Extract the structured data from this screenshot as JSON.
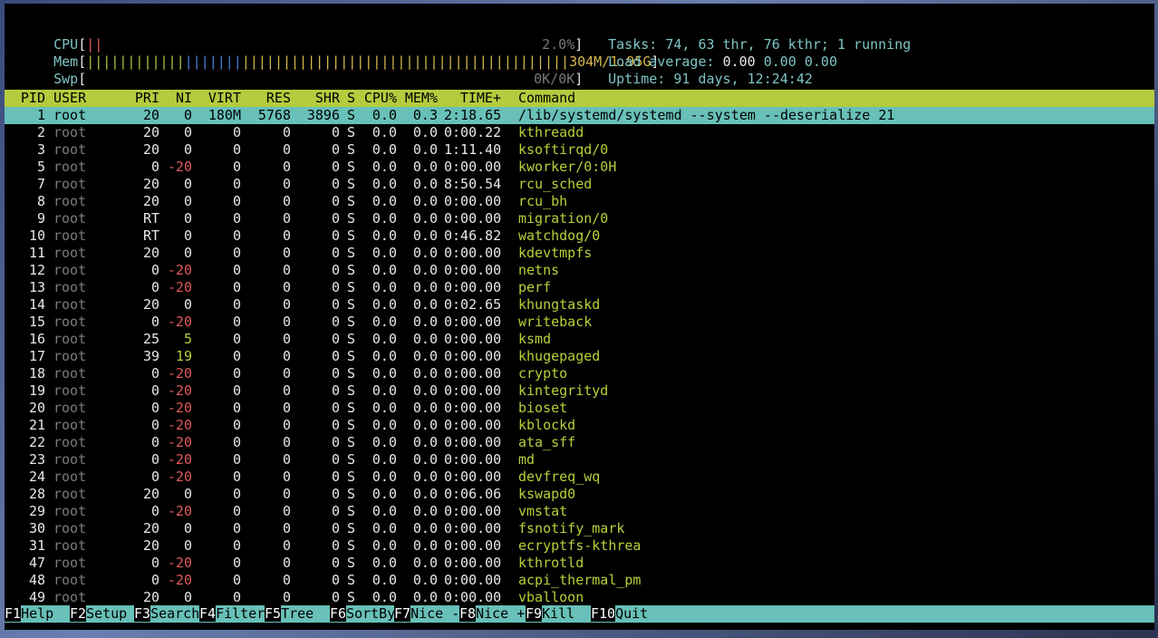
{
  "meters": {
    "cpu": {
      "label": "CPU",
      "bar": "||",
      "value": "2.0%"
    },
    "mem": {
      "label": "Mem",
      "bar_green": "||||||||||||",
      "bar_blue": "|||||||",
      "bar_yellow": "||||||||||||||||||||||||||||||||||||||||",
      "value": "304M/1.95G"
    },
    "swp": {
      "label": "Swp",
      "value": "0K/0K"
    }
  },
  "summary": {
    "tasks_label": "Tasks: ",
    "tasks": "74",
    "thr_sep": ", ",
    "thr": "63",
    "thr_label": " thr, ",
    "kthr": "76",
    "kthr_label": " kthr; ",
    "running": "1",
    "running_label": " running",
    "load_label": "Load average: ",
    "load1": "0.00",
    "load5": "0.00",
    "load15": "0.00",
    "uptime_label": "Uptime: ",
    "uptime": "91 days, 12:24:42"
  },
  "columns": {
    "pid": "PID",
    "user": "USER",
    "pri": "PRI",
    "ni": "NI",
    "virt": "VIRT",
    "res": "RES",
    "shr": "SHR",
    "s": "S",
    "cpu": "CPU%",
    "mem": "MEM%",
    "time": "TIME+",
    "command": "Command"
  },
  "processes": [
    {
      "pid": "1",
      "user": "root",
      "pri": "20",
      "ni": "0",
      "virt": "180M",
      "res": "5768",
      "shr": "3896",
      "s": "S",
      "cpu": "0.0",
      "mem": "0.3",
      "time": "2:18.65",
      "command": "/lib/systemd/systemd --system --deserialize 21"
    },
    {
      "pid": "2",
      "user": "root",
      "pri": "20",
      "ni": "0",
      "virt": "0",
      "res": "0",
      "shr": "0",
      "s": "S",
      "cpu": "0.0",
      "mem": "0.0",
      "time": "0:00.22",
      "command": "kthreadd"
    },
    {
      "pid": "3",
      "user": "root",
      "pri": "20",
      "ni": "0",
      "virt": "0",
      "res": "0",
      "shr": "0",
      "s": "S",
      "cpu": "0.0",
      "mem": "0.0",
      "time": "1:11.40",
      "command": "ksoftirqd/0"
    },
    {
      "pid": "5",
      "user": "root",
      "pri": "0",
      "ni": "-20",
      "virt": "0",
      "res": "0",
      "shr": "0",
      "s": "S",
      "cpu": "0.0",
      "mem": "0.0",
      "time": "0:00.00",
      "command": "kworker/0:0H"
    },
    {
      "pid": "7",
      "user": "root",
      "pri": "20",
      "ni": "0",
      "virt": "0",
      "res": "0",
      "shr": "0",
      "s": "S",
      "cpu": "0.0",
      "mem": "0.0",
      "time": "8:50.54",
      "command": "rcu_sched"
    },
    {
      "pid": "8",
      "user": "root",
      "pri": "20",
      "ni": "0",
      "virt": "0",
      "res": "0",
      "shr": "0",
      "s": "S",
      "cpu": "0.0",
      "mem": "0.0",
      "time": "0:00.00",
      "command": "rcu_bh"
    },
    {
      "pid": "9",
      "user": "root",
      "pri": "RT",
      "ni": "0",
      "virt": "0",
      "res": "0",
      "shr": "0",
      "s": "S",
      "cpu": "0.0",
      "mem": "0.0",
      "time": "0:00.00",
      "command": "migration/0"
    },
    {
      "pid": "10",
      "user": "root",
      "pri": "RT",
      "ni": "0",
      "virt": "0",
      "res": "0",
      "shr": "0",
      "s": "S",
      "cpu": "0.0",
      "mem": "0.0",
      "time": "0:46.82",
      "command": "watchdog/0"
    },
    {
      "pid": "11",
      "user": "root",
      "pri": "20",
      "ni": "0",
      "virt": "0",
      "res": "0",
      "shr": "0",
      "s": "S",
      "cpu": "0.0",
      "mem": "0.0",
      "time": "0:00.00",
      "command": "kdevtmpfs"
    },
    {
      "pid": "12",
      "user": "root",
      "pri": "0",
      "ni": "-20",
      "virt": "0",
      "res": "0",
      "shr": "0",
      "s": "S",
      "cpu": "0.0",
      "mem": "0.0",
      "time": "0:00.00",
      "command": "netns"
    },
    {
      "pid": "13",
      "user": "root",
      "pri": "0",
      "ni": "-20",
      "virt": "0",
      "res": "0",
      "shr": "0",
      "s": "S",
      "cpu": "0.0",
      "mem": "0.0",
      "time": "0:00.00",
      "command": "perf"
    },
    {
      "pid": "14",
      "user": "root",
      "pri": "20",
      "ni": "0",
      "virt": "0",
      "res": "0",
      "shr": "0",
      "s": "S",
      "cpu": "0.0",
      "mem": "0.0",
      "time": "0:02.65",
      "command": "khungtaskd"
    },
    {
      "pid": "15",
      "user": "root",
      "pri": "0",
      "ni": "-20",
      "virt": "0",
      "res": "0",
      "shr": "0",
      "s": "S",
      "cpu": "0.0",
      "mem": "0.0",
      "time": "0:00.00",
      "command": "writeback"
    },
    {
      "pid": "16",
      "user": "root",
      "pri": "25",
      "ni": "5",
      "virt": "0",
      "res": "0",
      "shr": "0",
      "s": "S",
      "cpu": "0.0",
      "mem": "0.0",
      "time": "0:00.00",
      "command": "ksmd"
    },
    {
      "pid": "17",
      "user": "root",
      "pri": "39",
      "ni": "19",
      "virt": "0",
      "res": "0",
      "shr": "0",
      "s": "S",
      "cpu": "0.0",
      "mem": "0.0",
      "time": "0:00.00",
      "command": "khugepaged"
    },
    {
      "pid": "18",
      "user": "root",
      "pri": "0",
      "ni": "-20",
      "virt": "0",
      "res": "0",
      "shr": "0",
      "s": "S",
      "cpu": "0.0",
      "mem": "0.0",
      "time": "0:00.00",
      "command": "crypto"
    },
    {
      "pid": "19",
      "user": "root",
      "pri": "0",
      "ni": "-20",
      "virt": "0",
      "res": "0",
      "shr": "0",
      "s": "S",
      "cpu": "0.0",
      "mem": "0.0",
      "time": "0:00.00",
      "command": "kintegrityd"
    },
    {
      "pid": "20",
      "user": "root",
      "pri": "0",
      "ni": "-20",
      "virt": "0",
      "res": "0",
      "shr": "0",
      "s": "S",
      "cpu": "0.0",
      "mem": "0.0",
      "time": "0:00.00",
      "command": "bioset"
    },
    {
      "pid": "21",
      "user": "root",
      "pri": "0",
      "ni": "-20",
      "virt": "0",
      "res": "0",
      "shr": "0",
      "s": "S",
      "cpu": "0.0",
      "mem": "0.0",
      "time": "0:00.00",
      "command": "kblockd"
    },
    {
      "pid": "22",
      "user": "root",
      "pri": "0",
      "ni": "-20",
      "virt": "0",
      "res": "0",
      "shr": "0",
      "s": "S",
      "cpu": "0.0",
      "mem": "0.0",
      "time": "0:00.00",
      "command": "ata_sff"
    },
    {
      "pid": "23",
      "user": "root",
      "pri": "0",
      "ni": "-20",
      "virt": "0",
      "res": "0",
      "shr": "0",
      "s": "S",
      "cpu": "0.0",
      "mem": "0.0",
      "time": "0:00.00",
      "command": "md"
    },
    {
      "pid": "24",
      "user": "root",
      "pri": "0",
      "ni": "-20",
      "virt": "0",
      "res": "0",
      "shr": "0",
      "s": "S",
      "cpu": "0.0",
      "mem": "0.0",
      "time": "0:00.00",
      "command": "devfreq_wq"
    },
    {
      "pid": "28",
      "user": "root",
      "pri": "20",
      "ni": "0",
      "virt": "0",
      "res": "0",
      "shr": "0",
      "s": "S",
      "cpu": "0.0",
      "mem": "0.0",
      "time": "0:06.06",
      "command": "kswapd0"
    },
    {
      "pid": "29",
      "user": "root",
      "pri": "0",
      "ni": "-20",
      "virt": "0",
      "res": "0",
      "shr": "0",
      "s": "S",
      "cpu": "0.0",
      "mem": "0.0",
      "time": "0:00.00",
      "command": "vmstat"
    },
    {
      "pid": "30",
      "user": "root",
      "pri": "20",
      "ni": "0",
      "virt": "0",
      "res": "0",
      "shr": "0",
      "s": "S",
      "cpu": "0.0",
      "mem": "0.0",
      "time": "0:00.00",
      "command": "fsnotify_mark"
    },
    {
      "pid": "31",
      "user": "root",
      "pri": "20",
      "ni": "0",
      "virt": "0",
      "res": "0",
      "shr": "0",
      "s": "S",
      "cpu": "0.0",
      "mem": "0.0",
      "time": "0:00.00",
      "command": "ecryptfs-kthrea"
    },
    {
      "pid": "47",
      "user": "root",
      "pri": "0",
      "ni": "-20",
      "virt": "0",
      "res": "0",
      "shr": "0",
      "s": "S",
      "cpu": "0.0",
      "mem": "0.0",
      "time": "0:00.00",
      "command": "kthrotld"
    },
    {
      "pid": "48",
      "user": "root",
      "pri": "0",
      "ni": "-20",
      "virt": "0",
      "res": "0",
      "shr": "0",
      "s": "S",
      "cpu": "0.0",
      "mem": "0.0",
      "time": "0:00.00",
      "command": "acpi_thermal_pm"
    },
    {
      "pid": "49",
      "user": "root",
      "pri": "20",
      "ni": "0",
      "virt": "0",
      "res": "0",
      "shr": "0",
      "s": "S",
      "cpu": "0.0",
      "mem": "0.0",
      "time": "0:00.00",
      "command": "vballoon"
    }
  ],
  "function_keys": [
    {
      "key": "F1",
      "label": "Help  "
    },
    {
      "key": "F2",
      "label": "Setup "
    },
    {
      "key": "F3",
      "label": "Search"
    },
    {
      "key": "F4",
      "label": "Filter"
    },
    {
      "key": "F5",
      "label": "Tree  "
    },
    {
      "key": "F6",
      "label": "SortBy"
    },
    {
      "key": "F7",
      "label": "Nice -"
    },
    {
      "key": "F8",
      "label": "Nice +"
    },
    {
      "key": "F9",
      "label": "Kill  "
    },
    {
      "key": "F10",
      "label": "Quit  "
    }
  ],
  "colors": {
    "header_bg": "#b5cb3e",
    "selected_bg": "#68c0b8",
    "command_color": "#b8cf3a",
    "negative_nice": "#e05a5a"
  }
}
